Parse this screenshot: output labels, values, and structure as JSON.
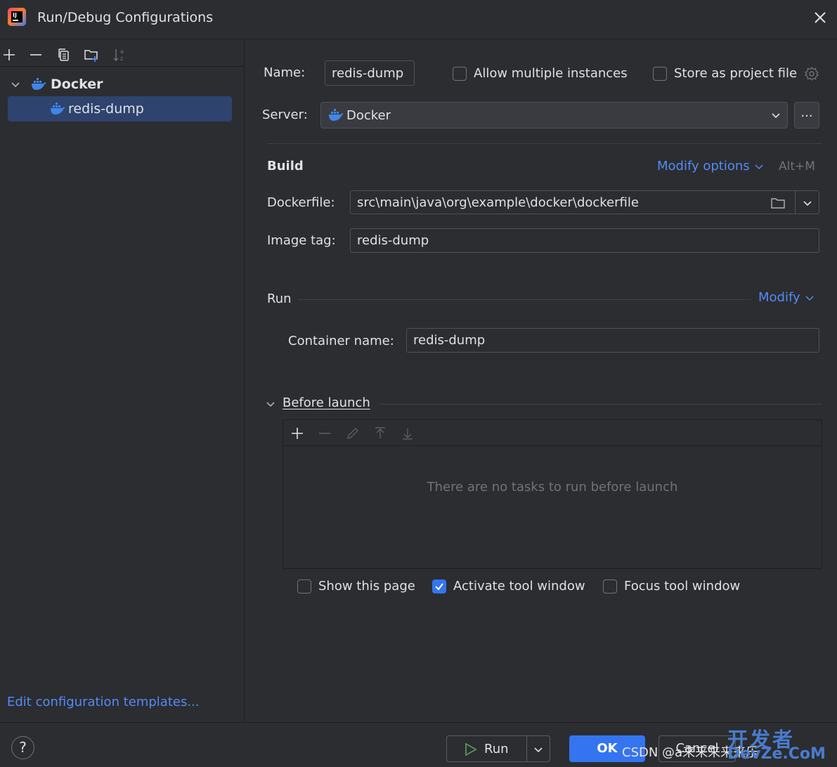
{
  "window": {
    "title": "Run/Debug Configurations"
  },
  "sidebar": {
    "toolbar": [
      "add-icon",
      "remove-icon",
      "copy-icon",
      "new-folder-icon",
      "sort-alpha-icon"
    ],
    "tree": {
      "group_label": "Docker",
      "selected_item": "redis-dump"
    },
    "edit_templates_link": "Edit configuration templates..."
  },
  "form": {
    "name_label": "Name:",
    "name_value": "redis-dump",
    "allow_multiple_label": "Allow multiple instances",
    "store_project_label": "Store as project file",
    "server_label": "Server:",
    "server_value": "Docker",
    "server_browse": "...",
    "build": {
      "title": "Build",
      "modify_options": "Modify options",
      "shortcut": "Alt+M",
      "dockerfile_label": "Dockerfile:",
      "dockerfile_value": "src\\main\\java\\org\\example\\docker\\dockerfile",
      "image_tag_label": "Image tag:",
      "image_tag_value": "redis-dump"
    },
    "run": {
      "title": "Run",
      "modify": "Modify",
      "container_name_label": "Container name:",
      "container_name_value": "redis-dump"
    },
    "before_launch": {
      "title": "Before launch",
      "empty_text": "There are no tasks to run before launch",
      "show_page_label": "Show this page",
      "show_page_checked": false,
      "activate_tool_label": "Activate tool window",
      "activate_tool_checked": true,
      "focus_tool_label": "Focus tool window",
      "focus_tool_checked": false
    }
  },
  "footer": {
    "help": "?",
    "run_label": "Run",
    "ok_label": "OK",
    "cancel_label": "Cancel",
    "watermark": "CSDN @a来来来来来乐",
    "watermark_site": "开发者",
    "watermark_site2": "DevZe.CoM"
  },
  "colors": {
    "accent": "#3574f0",
    "link": "#548af7",
    "selection": "#2e436e",
    "docker_blue": "#3f86e8"
  }
}
